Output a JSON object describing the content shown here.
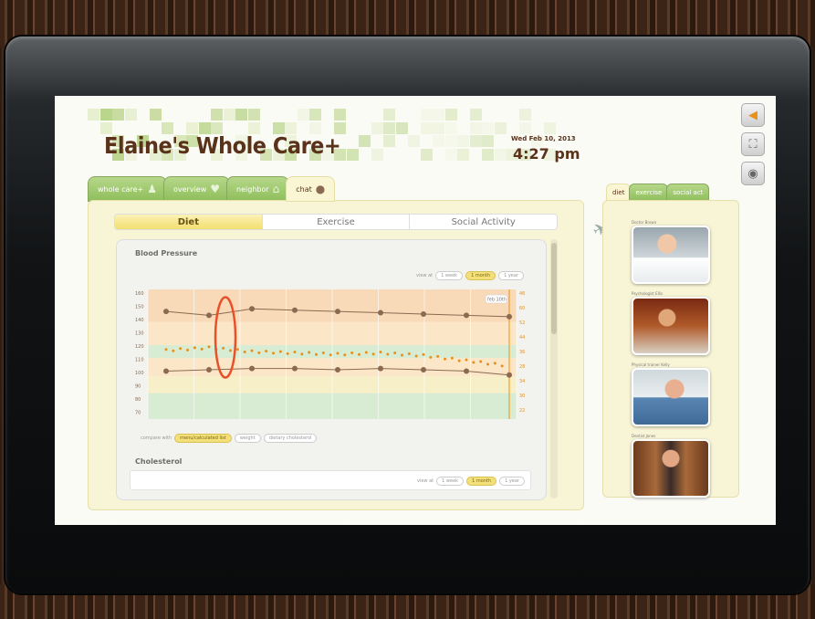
{
  "app": {
    "title": "Elaine's Whole Care+",
    "date": "Wed Feb 10, 2013",
    "time": "4:27 pm"
  },
  "top_tabs": [
    {
      "label": "whole care+",
      "icon": "person-icon"
    },
    {
      "label": "overview",
      "icon": "heart-icon"
    },
    {
      "label": "neighbor",
      "icon": "house-icon"
    },
    {
      "label": "chat",
      "icon": "chat-bubbles-icon"
    }
  ],
  "active_top_tab": "chat",
  "sub_tabs": [
    "Diet",
    "Exercise",
    "Social Activity"
  ],
  "active_sub_tab": "Diet",
  "blood_pressure": {
    "title": "Blood Pressure",
    "view_label": "view at",
    "view_options": [
      "1 week",
      "1 month",
      "1 year"
    ],
    "view_selected": "1 month",
    "compare_label": "compare with",
    "compare_options": [
      "menu/calculated list",
      "weight",
      "dietary cholesterol"
    ],
    "compare_selected": "menu/calculated list",
    "date_marker": "feb 10th"
  },
  "cholesterol": {
    "title": "Cholesterol",
    "view_label": "view at",
    "view_options": [
      "1 week",
      "1 month",
      "1 year"
    ],
    "view_selected": "1 month"
  },
  "right_tabs": [
    "diet",
    "exercise",
    "social act"
  ],
  "active_right_tab": "diet",
  "contacts": [
    {
      "name": "Doctor Brown"
    },
    {
      "name": "Psychologist Ellis"
    },
    {
      "name": "Physical trainer Kelly"
    },
    {
      "name": "Dentist Jones"
    }
  ],
  "side_buttons": [
    "speaker-icon",
    "screens-icon",
    "camera-icon"
  ],
  "chart_data": {
    "type": "line",
    "y_ticks_left": [
      "160",
      "150",
      "140",
      "130",
      "120",
      "110",
      "100",
      "90",
      "80",
      "70"
    ],
    "y_ticks_right": [
      "46",
      "60",
      "52",
      "44",
      "36",
      "28",
      "34",
      "30",
      "22"
    ],
    "series": [
      {
        "values": [
          148,
          145,
          150,
          149,
          148,
          147,
          146,
          145,
          144
        ]
      },
      {
        "values": [
          102,
          103,
          104,
          104,
          103,
          104,
          103,
          102,
          99
        ]
      },
      {
        "values": [
          118,
          120,
          117,
          116,
          115,
          116,
          114,
          110,
          106
        ]
      }
    ],
    "colors": {
      "systolic": "#8b6a4f",
      "diastolic": "#8b6a4f",
      "comparison": "#e8901c",
      "highlight": "#e8502a"
    }
  }
}
